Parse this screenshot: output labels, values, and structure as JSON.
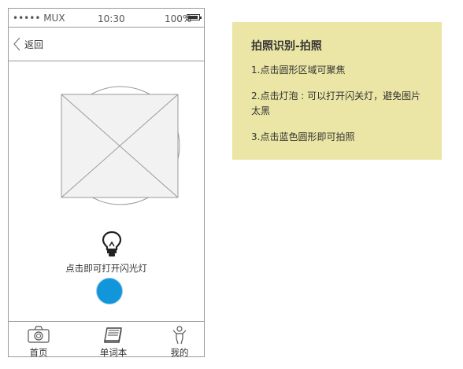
{
  "status_bar": {
    "carrier": "••••• MUX",
    "time": "10:30",
    "battery": "100%"
  },
  "nav": {
    "back_label": "返回"
  },
  "camera": {
    "flash_hint": "点击即可打开闪光灯",
    "shutter_color": "#1296db"
  },
  "tabs": [
    {
      "label": "首页",
      "icon": "camera-icon"
    },
    {
      "label": "单词本",
      "icon": "notebook-icon"
    },
    {
      "label": "我的",
      "icon": "person-icon"
    }
  ],
  "note": {
    "title": "拍照识别-拍照",
    "items": [
      "1.点击圆形区域可聚焦",
      "2.点击灯泡 : 可以打开闪关灯，避免图片太黑",
      "3.点击蓝色圆形即可拍照"
    ],
    "background": "#ebe6a5"
  }
}
